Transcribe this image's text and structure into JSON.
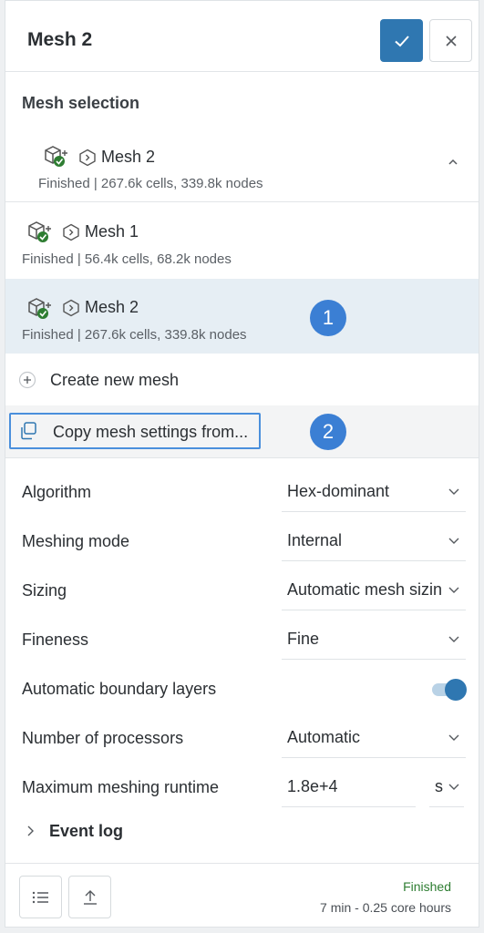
{
  "header": {
    "title": "Mesh 2"
  },
  "mesh_selection": {
    "label": "Mesh selection",
    "current": {
      "name": "Mesh 2",
      "status": "Finished | 267.6k cells, 339.8k nodes"
    },
    "options": [
      {
        "name": "Mesh 1",
        "status": "Finished | 56.4k cells, 68.2k nodes"
      },
      {
        "name": "Mesh 2",
        "status": "Finished | 267.6k cells, 339.8k nodes"
      }
    ],
    "create_label": "Create new mesh",
    "copy_label": "Copy mesh settings from..."
  },
  "badges": [
    "1",
    "2"
  ],
  "settings": {
    "algorithm": {
      "label": "Algorithm",
      "value": "Hex-dominant"
    },
    "meshing_mode": {
      "label": "Meshing mode",
      "value": "Internal"
    },
    "sizing": {
      "label": "Sizing",
      "value": "Automatic mesh sizing"
    },
    "fineness": {
      "label": "Fineness",
      "value": "Fine"
    },
    "boundary_layers": {
      "label": "Automatic boundary layers",
      "enabled": true
    },
    "processors": {
      "label": "Number of processors",
      "value": "Automatic"
    },
    "runtime": {
      "label": "Maximum meshing runtime",
      "value": "1.8e+4",
      "unit": "s"
    }
  },
  "event_log": {
    "label": "Event log"
  },
  "footer": {
    "status": "Finished",
    "summary": "7 min - 0.25 core hours"
  },
  "colors": {
    "primary": "#2f77b1",
    "badge": "#3b7fd4",
    "highlight": "#e6eef4",
    "success": "#2e7d32"
  },
  "icons": [
    "check-icon",
    "close-icon",
    "mesh-icon",
    "chevron-up-icon",
    "plus-icon",
    "copy-icon",
    "chevron-down-icon",
    "chevron-right-icon",
    "list-icon",
    "upload-icon"
  ]
}
